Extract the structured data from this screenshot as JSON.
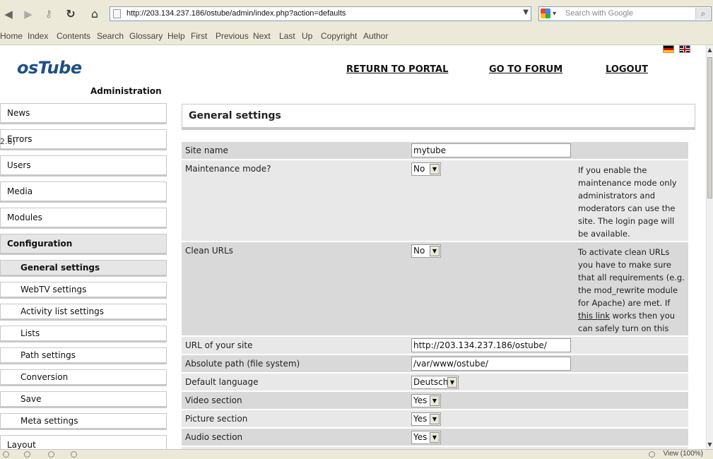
{
  "browser": {
    "url": "http://203.134.237.186/ostube/admin/index.php?action=defaults",
    "search_placeholder": "Search with Google",
    "status_text": "View (100%)"
  },
  "navbar": {
    "items": [
      "Home",
      "Index",
      "Contents",
      "Search",
      "Glossary",
      "Help",
      "First",
      "Previous",
      "Next",
      "Last",
      "Up",
      "Copyright",
      "Author"
    ]
  },
  "header": {
    "logo": "osTube",
    "subtitle": "Administration",
    "links": [
      "RETURN TO PORTAL",
      "GO TO FORUM",
      "LOGOUT"
    ]
  },
  "sidebar": {
    "items": [
      "News",
      "Errors",
      "Users",
      "Media",
      "Modules",
      "Configuration"
    ],
    "active": "Configuration",
    "stray_text": "2.8)",
    "subitems": [
      "General settings",
      "WebTV settings",
      "Activity list settings",
      "Lists",
      "Path settings",
      "Conversion",
      "Save",
      "Meta settings"
    ],
    "active_sub": "General settings",
    "last_item": "Layout"
  },
  "main": {
    "title": "General settings",
    "settings": [
      {
        "label": "Site name",
        "type": "text",
        "value": "mytube",
        "help": ""
      },
      {
        "label": "Maintenance mode?",
        "type": "select",
        "value": "No",
        "help": "If you enable the maintenance mode only administrators and moderators can use the site. The login page will be available."
      },
      {
        "label": "Clean URLs",
        "type": "select",
        "value": "No",
        "help_before": "To activate clean URLs you have to make sure that all requirements (e.g. the mod_rewrite module for Apache) are met. If ",
        "help_link": "this link",
        "help_after": " works then you can safely turn on this feature."
      },
      {
        "label": "URL of your site",
        "type": "text",
        "value": "http://203.134.237.186/ostube/",
        "help": ""
      },
      {
        "label": "Absolute path (file system)",
        "type": "text",
        "value": "/var/www/ostube/",
        "help": ""
      },
      {
        "label": "Default language",
        "type": "select",
        "value": "Deutsch",
        "help": ""
      },
      {
        "label": "Video section",
        "type": "select",
        "value": "Yes",
        "help": ""
      },
      {
        "label": "Picture section",
        "type": "select",
        "value": "Yes",
        "help": ""
      },
      {
        "label": "Audio section",
        "type": "select",
        "value": "Yes",
        "help": ""
      }
    ]
  }
}
